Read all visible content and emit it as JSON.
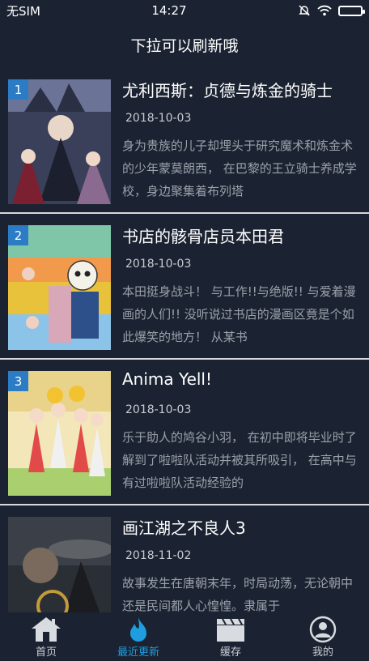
{
  "status": {
    "carrier": "无SIM",
    "time": "14:27"
  },
  "header": {
    "title": "下拉可以刷新哦"
  },
  "items": [
    {
      "rank": "1",
      "title": "尤利西斯：贞德与炼金的骑士",
      "date": "2018-10-03",
      "desc": "身为贵族的儿子却埋头于研究魔术和炼金术的少年蒙莫朗西， 在巴黎的王立骑士养成学校，身边聚集着布列塔"
    },
    {
      "rank": "2",
      "title": "书店的骸骨店员本田君",
      "date": "2018-10-03",
      "desc": "本田挺身战斗！ 与工作!!与绝版!! 与爱着漫画的人们!! 没听说过书店的漫画区竟是个如此爆笑的地方！ 从某书"
    },
    {
      "rank": "3",
      "title": "Anima Yell!",
      "date": "2018-10-03",
      "desc": "乐于助人的鸠谷小羽， 在初中即将毕业时了解到了啦啦队活动并被其所吸引， 在高中与有过啦啦队活动经验的"
    },
    {
      "rank": "",
      "title": "画江湖之不良人3",
      "date": "2018-11-02",
      "desc": "故事发生在唐朝末年，时局动荡，无论朝中还是民间都人心惶惶。隶属于"
    }
  ],
  "tabs": [
    {
      "label": "首页",
      "icon": "home-icon",
      "active": false
    },
    {
      "label": "最近更新",
      "icon": "flame-icon",
      "active": true
    },
    {
      "label": "缓存",
      "icon": "clapperboard-icon",
      "active": false
    },
    {
      "label": "我的",
      "icon": "user-icon",
      "active": false
    }
  ],
  "colors": {
    "background": "#1b2332",
    "accent": "#1e9ee0",
    "rank_badge": "#2c7cc5",
    "divider": "#d8d8d8"
  }
}
